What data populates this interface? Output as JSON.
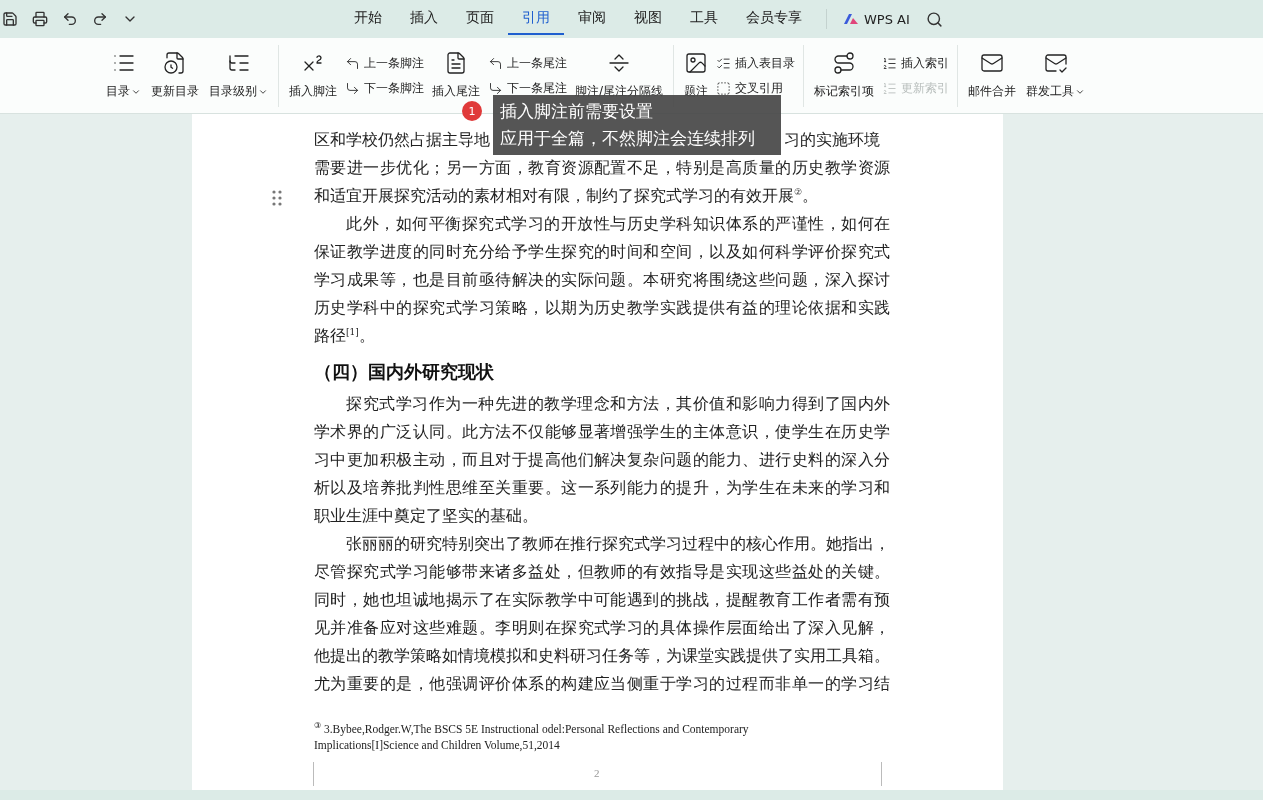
{
  "tabs": [
    {
      "label": "开始",
      "selected": false
    },
    {
      "label": "插入",
      "selected": false
    },
    {
      "label": "页面",
      "selected": false
    },
    {
      "label": "引用",
      "selected": true
    },
    {
      "label": "审阅",
      "selected": false
    },
    {
      "label": "视图",
      "selected": false
    },
    {
      "label": "工具",
      "selected": false
    },
    {
      "label": "会员专享",
      "selected": false
    }
  ],
  "ai_button": "WPS AI",
  "ribbon": [
    {
      "items": [
        {
          "kind": "large",
          "label": "目录",
          "dropdown": true
        },
        {
          "kind": "large",
          "label": "更新目录",
          "dropdown": false
        },
        {
          "kind": "large",
          "label": "目录级别",
          "dropdown": true
        }
      ]
    },
    {
      "items": [
        {
          "kind": "large",
          "label": "插入脚注",
          "dropdown": false
        },
        {
          "kind": "stack",
          "items": [
            {
              "label": "上一条脚注",
              "disabled": false
            },
            {
              "label": "下一条脚注",
              "disabled": false
            }
          ]
        },
        {
          "kind": "large",
          "label": "插入尾注",
          "dropdown": false
        },
        {
          "kind": "stack",
          "items": [
            {
              "label": "上一条尾注",
              "disabled": false
            },
            {
              "label": "下一条尾注",
              "disabled": false
            }
          ]
        },
        {
          "kind": "large",
          "label": "脚注/尾注分隔线",
          "dropdown": false
        }
      ]
    },
    {
      "items": [
        {
          "kind": "large",
          "label": "题注",
          "dropdown": false
        },
        {
          "kind": "stack",
          "items": [
            {
              "label": "插入表目录",
              "disabled": false
            },
            {
              "label": "交叉引用",
              "disabled": false
            }
          ]
        }
      ]
    },
    {
      "items": [
        {
          "kind": "large",
          "label": "标记索引项",
          "dropdown": false
        },
        {
          "kind": "stack",
          "items": [
            {
              "label": "插入索引",
              "disabled": false
            },
            {
              "label": "更新索引",
              "disabled": true
            }
          ]
        }
      ]
    },
    {
      "items": [
        {
          "kind": "large",
          "label": "邮件合并",
          "dropdown": false
        },
        {
          "kind": "large",
          "label": "群发工具",
          "dropdown": true
        }
      ]
    }
  ],
  "tooltip": {
    "badge": "1",
    "lines": [
      "插入脚注前需要设置",
      "应用于全篇，不然脚注会连续排列"
    ]
  },
  "document": {
    "partial_line": [
      "区和学校仍然占据主导地",
      "习的实施环境"
    ],
    "blocks": [
      {
        "kind": "paragraph",
        "indent": false,
        "lines": [
          "需要进一步优化；另一方面，教育资源配置不足，特别是高质量的历史教学资源",
          "和适宜开展探究活动的素材相对有限，制约了探究式学习的有效开展$^{②}$。"
        ]
      },
      {
        "kind": "paragraph",
        "indent": true,
        "lines": [
          "此外，如何平衡探究式学习的开放性与历史学科知识体系的严谨性，如何在",
          "保证教学进度的同时充分给予学生探究的时间和空间，以及如何科学评价探究式",
          "学习成果等，也是目前亟待解决的实际问题。本研究将围绕这些问题，深入探讨",
          "历史学科中的探究式学习策略，以期为历史教学实践提供有益的理论依据和实践",
          "路径$^{[1]}$。"
        ]
      },
      {
        "kind": "heading",
        "text": "（四）国内外研究现状"
      },
      {
        "kind": "paragraph",
        "indent": true,
        "lines": [
          "探究式学习作为一种先进的教学理念和方法，其价值和影响力得到了国内外",
          "学术界的广泛认同。此方法不仅能够显著增强学生的主体意识，使学生在历史学",
          "习中更加积极主动，而且对于提高他们解决复杂问题的能力、进行史料的深入分",
          "析以及培养批判性思维至关重要。这一系列能力的提升，为学生在未来的学习和",
          "职业生涯中奠定了坚实的基础。"
        ]
      },
      {
        "kind": "paragraph",
        "indent": true,
        "cut": true,
        "lines": [
          "张丽丽的研究特别突出了教师在推行探究式学习过程中的核心作用。她指出，",
          "尽管探究式学习能够带来诸多益处，但教师的有效指导是实现这些益处的关键。",
          "同时，她也坦诚地揭示了在实际教学中可能遇到的挑战，提醒教育工作者需有预",
          "见并准备应对这些难题。李明则在探究式学习的具体操作层面给出了深入见解，",
          "他提出的教学策略如情境模拟和史料研习任务等，为课堂实践提供了实用工具箱。",
          "尤为重要的是，他强调评价体系的构建应当侧重于学习的过程而非单一的学习结"
        ]
      }
    ]
  },
  "footnote": [
    "$^{③}$ 3.Bybee,Rodger.W,The BSCS 5E Instructional odel:Personal Reflections and Contemporary",
    "Implications[I]Science and Children Volume,51,2014"
  ],
  "page_number": "2"
}
